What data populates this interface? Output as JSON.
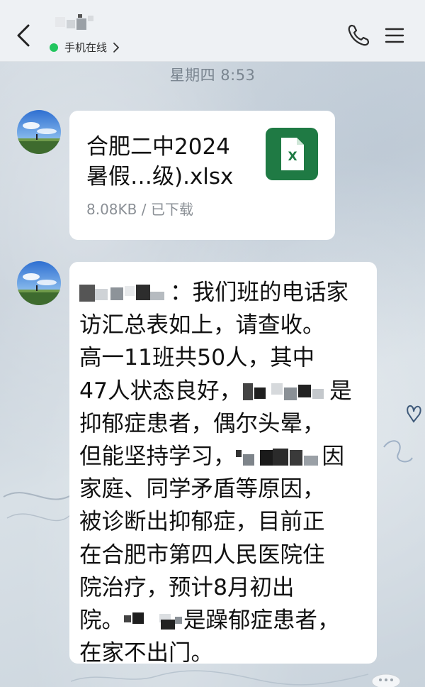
{
  "header": {
    "contact_name_redacted": true,
    "status_text": "手机在线",
    "status_color": "#22c55e",
    "icons": {
      "back": "chevron-left-icon",
      "phone": "phone-icon",
      "menu": "menu-icon",
      "status_chevron": "chevron-right-icon"
    }
  },
  "timestamp": "星期四 8:53",
  "messages": [
    {
      "type": "file",
      "file_name_line1": "合肥二中2024",
      "file_name_line2": "暑假…级).xlsx",
      "file_meta": "8.08KB / 已下载",
      "file_icon": "excel-file-icon",
      "file_icon_letter": "X",
      "file_icon_color": "#1f7a44"
    },
    {
      "type": "text",
      "lines": [
        {
          "before": "",
          "after": "：我们班的电话家"
        },
        {
          "text": "访汇总表如上，请查收。"
        },
        {
          "text": "高一11班共50人，其中"
        },
        {
          "before": "47人状态良好，",
          "after": "是"
        },
        {
          "text": "抑郁症患者，偶尔头晕，"
        },
        {
          "before": "但能坚持学习，",
          "after": "因"
        },
        {
          "text": "家庭、同学矛盾等原因，"
        },
        {
          "text": "被诊断出抑郁症，目前正"
        },
        {
          "text": "在合肥市第四人民医院住"
        },
        {
          "text": "院治疗，预计8月初出"
        },
        {
          "before": "院。",
          "after": "是躁郁症患者，"
        },
        {
          "text": "在家不出门。"
        }
      ]
    }
  ]
}
